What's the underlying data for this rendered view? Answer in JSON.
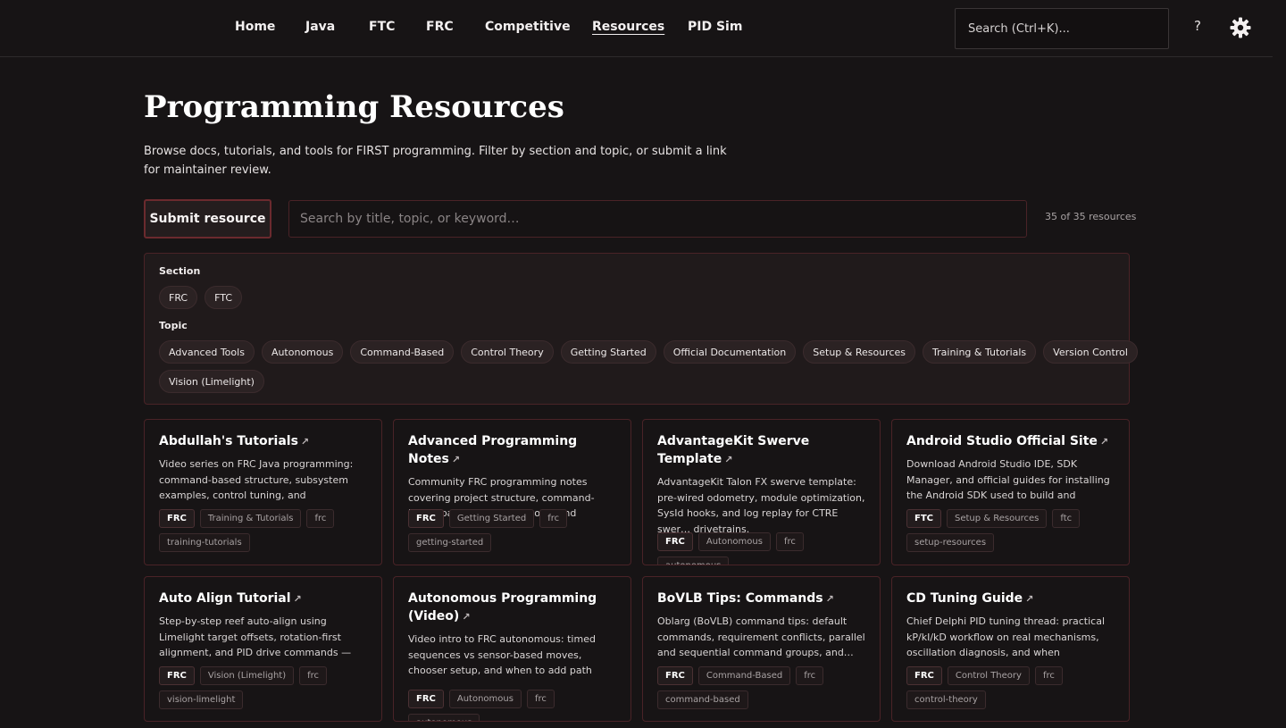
{
  "nav": {
    "links": [
      "Home",
      "Java",
      "FTC",
      "FRC",
      "Competitive",
      "Resources",
      "PID Sim"
    ],
    "active": "Resources",
    "search_placeholder": "Search (Ctrl+K)...",
    "help_label": "?",
    "theme_icon": "gear-icon"
  },
  "page": {
    "title": "Programming Resources",
    "description": "Browse docs, tutorials, and tools for FIRST programming. Filter by section and topic, or submit a link for maintainer review."
  },
  "toolbar": {
    "submit_label": "Submit resource",
    "search_placeholder": "Search by title, topic, or keyword…",
    "count_text": "35 of 35 resources"
  },
  "filters": {
    "section_label": "Section",
    "sections": [
      "FRC",
      "FTC"
    ],
    "topic_label": "Topic",
    "topics_row1": [
      "Advanced Tools",
      "Autonomous",
      "Command-Based",
      "Control Theory",
      "Getting Started",
      "Official Documentation",
      "Setup & Resources",
      "Training & Tutorials",
      "Version Control"
    ],
    "topics_row2": [
      "Vision (Limelight)"
    ]
  },
  "cards": [
    {
      "title": "Abdullah's Tutorials",
      "desc": "Video series on FRC Java programming: command-based structure, subsystem examples, control tuning, and competitio…",
      "section": "FRC",
      "tags": [
        "Training & Tutorials",
        "frc",
        "training-tutorials"
      ]
    },
    {
      "title": "Advanced Programming Notes",
      "desc": "Community FRC programming notes covering project structure, command-based patterns, control loops, and common…",
      "section": "FRC",
      "tags": [
        "Getting Started",
        "frc",
        "getting-started"
      ]
    },
    {
      "title": "AdvantageKit Swerve Template",
      "desc": "AdvantageKit Talon FX swerve template: pre-wired odometry, module optimization, SysId hooks, and log replay for CTRE swer… drivetrains.",
      "section": "FRC",
      "tags": [
        "Autonomous",
        "frc",
        "autonomous"
      ]
    },
    {
      "title": "Android Studio Official Site",
      "desc": "Download Android Studio IDE, SDK Manager, and official guides for installing the Android SDK used to build and deploy…",
      "section": "FTC",
      "tags": [
        "Setup & Resources",
        "ftc",
        "setup-resources"
      ]
    },
    {
      "title": "Auto Align Tutorial",
      "desc": "Step-by-step reef auto-align using Limelight target offsets, rotation-first alignment, and PID drive commands — includes code…",
      "section": "FRC",
      "tags": [
        "Vision (Limelight)",
        "frc",
        "vision-limelight"
      ]
    },
    {
      "title": "Autonomous Programming (Video)",
      "desc": "Video intro to FRC autonomous: timed sequences vs sensor-based moves, chooser setup, and when to add path following to …",
      "section": "FRC",
      "tags": [
        "Autonomous",
        "frc",
        "autonomous"
      ]
    },
    {
      "title": "BoVLB Tips: Commands",
      "desc": "Oblarg (BoVLB) command tips: default commands, requirement conflicts, parallel and sequential command groups, and…",
      "section": "FRC",
      "tags": [
        "Command-Based",
        "frc",
        "command-based"
      ]
    },
    {
      "title": "CD Tuning Guide",
      "desc": "Chief Delphi PID tuning thread: practical kP/kI/kD workflow on real mechanisms, oscillation diagnosis, and when feedforw…",
      "section": "FRC",
      "tags": [
        "Control Theory",
        "frc",
        "control-theory"
      ]
    }
  ]
}
